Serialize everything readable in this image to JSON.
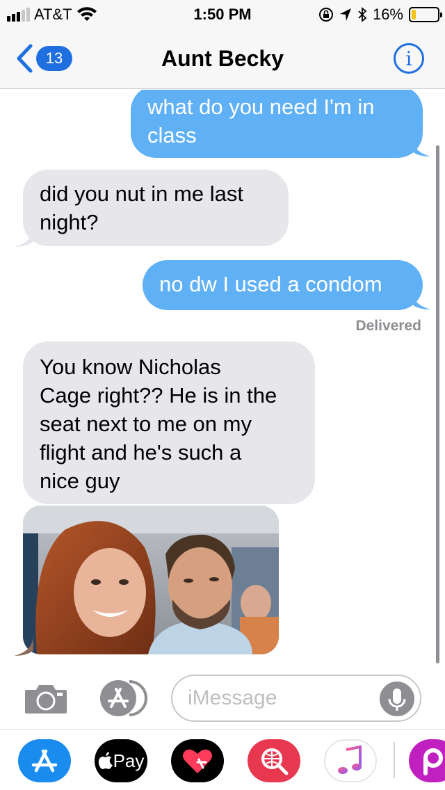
{
  "status_bar": {
    "carrier": "AT&T",
    "time": "1:50 PM",
    "battery": "16%",
    "battery_level": 0.16,
    "icons": [
      "signal-icon",
      "wifi-icon",
      "rotation-lock-icon",
      "location-icon",
      "bluetooth-icon",
      "battery-icon"
    ]
  },
  "nav": {
    "back_count": "13",
    "title": "Aunt Becky",
    "info_label": "i"
  },
  "messages": [
    {
      "direction": "outgoing",
      "text": "what do you need I'm in class"
    },
    {
      "direction": "incoming",
      "text": "did you nut in me last night?"
    },
    {
      "direction": "outgoing",
      "text": "no dw I used a condom"
    },
    {
      "direction": "incoming",
      "text": "You know Nicholas Cage right?? He is in the seat next to me on my flight and he's such a nice guy"
    },
    {
      "direction": "incoming",
      "type": "photo"
    }
  ],
  "message_lines": {
    "m1": [
      "what do you need I'm in",
      "class"
    ],
    "m2": [
      "did you nut in me last",
      "night?"
    ],
    "m3": [
      "no dw I used a condom"
    ],
    "m4": [
      "You know Nicholas",
      "Cage right?? He is in the",
      "seat next to me on my",
      "flight and he's such a",
      "nice guy"
    ]
  },
  "delivered_label": "Delivered",
  "input": {
    "placeholder": "iMessage"
  },
  "apps": [
    {
      "name": "App Store",
      "icon": "app-store-icon",
      "color": "#1a8cf0"
    },
    {
      "name": "Apple Pay",
      "label": "Pay",
      "icon": "apple-pay-icon",
      "color": "#000000"
    },
    {
      "name": "Digital Touch",
      "icon": "digital-touch-icon",
      "color": "#000000"
    },
    {
      "name": "Search Images",
      "icon": "image-search-icon",
      "color": "#e8384f"
    },
    {
      "name": "Music",
      "icon": "music-icon",
      "color": "#ffffff"
    },
    {
      "name": "Picsart",
      "icon": "picsart-icon",
      "color": "#c020c0"
    }
  ],
  "colors": {
    "outgoing_bubble": "#5fb0f5",
    "incoming_bubble": "#e6e6eb",
    "accent": "#1f6fe0"
  }
}
